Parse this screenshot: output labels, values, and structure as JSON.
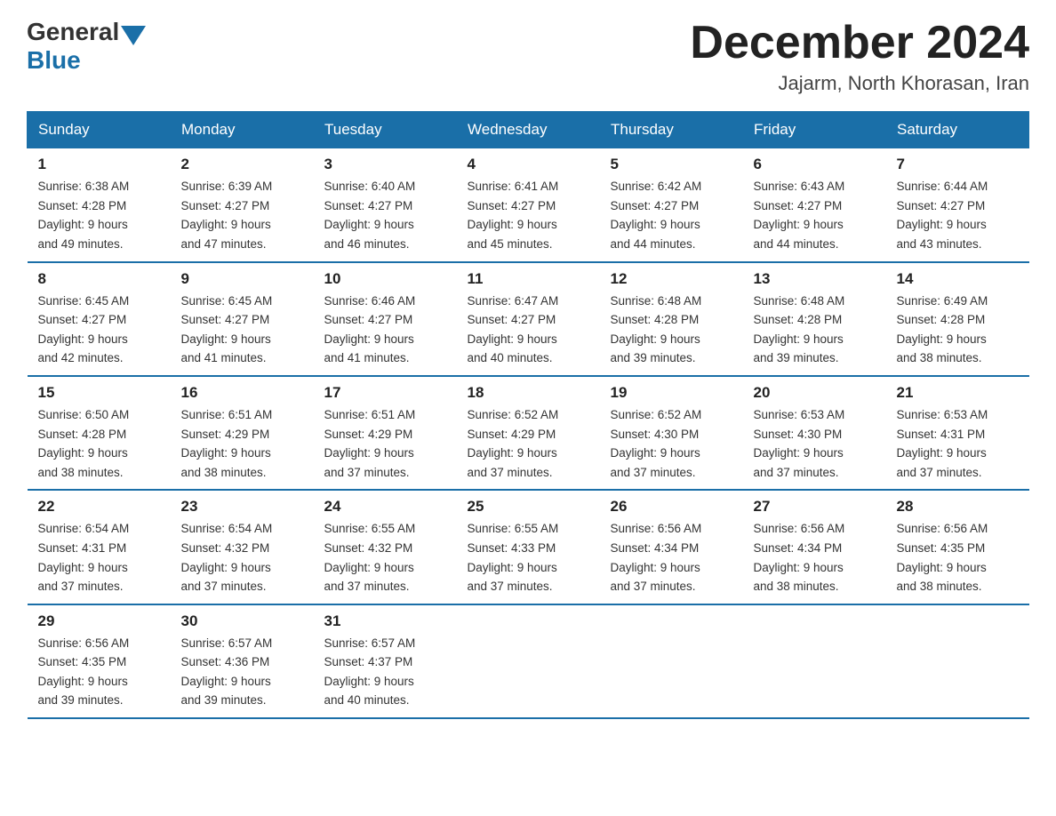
{
  "header": {
    "logo": {
      "general": "General",
      "blue": "Blue"
    },
    "title": "December 2024",
    "location": "Jajarm, North Khorasan, Iran"
  },
  "weekdays": [
    "Sunday",
    "Monday",
    "Tuesday",
    "Wednesday",
    "Thursday",
    "Friday",
    "Saturday"
  ],
  "weeks": [
    [
      {
        "day": "1",
        "sunrise": "6:38 AM",
        "sunset": "4:28 PM",
        "daylight": "9 hours and 49 minutes."
      },
      {
        "day": "2",
        "sunrise": "6:39 AM",
        "sunset": "4:27 PM",
        "daylight": "9 hours and 47 minutes."
      },
      {
        "day": "3",
        "sunrise": "6:40 AM",
        "sunset": "4:27 PM",
        "daylight": "9 hours and 46 minutes."
      },
      {
        "day": "4",
        "sunrise": "6:41 AM",
        "sunset": "4:27 PM",
        "daylight": "9 hours and 45 minutes."
      },
      {
        "day": "5",
        "sunrise": "6:42 AM",
        "sunset": "4:27 PM",
        "daylight": "9 hours and 44 minutes."
      },
      {
        "day": "6",
        "sunrise": "6:43 AM",
        "sunset": "4:27 PM",
        "daylight": "9 hours and 44 minutes."
      },
      {
        "day": "7",
        "sunrise": "6:44 AM",
        "sunset": "4:27 PM",
        "daylight": "9 hours and 43 minutes."
      }
    ],
    [
      {
        "day": "8",
        "sunrise": "6:45 AM",
        "sunset": "4:27 PM",
        "daylight": "9 hours and 42 minutes."
      },
      {
        "day": "9",
        "sunrise": "6:45 AM",
        "sunset": "4:27 PM",
        "daylight": "9 hours and 41 minutes."
      },
      {
        "day": "10",
        "sunrise": "6:46 AM",
        "sunset": "4:27 PM",
        "daylight": "9 hours and 41 minutes."
      },
      {
        "day": "11",
        "sunrise": "6:47 AM",
        "sunset": "4:27 PM",
        "daylight": "9 hours and 40 minutes."
      },
      {
        "day": "12",
        "sunrise": "6:48 AM",
        "sunset": "4:28 PM",
        "daylight": "9 hours and 39 minutes."
      },
      {
        "day": "13",
        "sunrise": "6:48 AM",
        "sunset": "4:28 PM",
        "daylight": "9 hours and 39 minutes."
      },
      {
        "day": "14",
        "sunrise": "6:49 AM",
        "sunset": "4:28 PM",
        "daylight": "9 hours and 38 minutes."
      }
    ],
    [
      {
        "day": "15",
        "sunrise": "6:50 AM",
        "sunset": "4:28 PM",
        "daylight": "9 hours and 38 minutes."
      },
      {
        "day": "16",
        "sunrise": "6:51 AM",
        "sunset": "4:29 PM",
        "daylight": "9 hours and 38 minutes."
      },
      {
        "day": "17",
        "sunrise": "6:51 AM",
        "sunset": "4:29 PM",
        "daylight": "9 hours and 37 minutes."
      },
      {
        "day": "18",
        "sunrise": "6:52 AM",
        "sunset": "4:29 PM",
        "daylight": "9 hours and 37 minutes."
      },
      {
        "day": "19",
        "sunrise": "6:52 AM",
        "sunset": "4:30 PM",
        "daylight": "9 hours and 37 minutes."
      },
      {
        "day": "20",
        "sunrise": "6:53 AM",
        "sunset": "4:30 PM",
        "daylight": "9 hours and 37 minutes."
      },
      {
        "day": "21",
        "sunrise": "6:53 AM",
        "sunset": "4:31 PM",
        "daylight": "9 hours and 37 minutes."
      }
    ],
    [
      {
        "day": "22",
        "sunrise": "6:54 AM",
        "sunset": "4:31 PM",
        "daylight": "9 hours and 37 minutes."
      },
      {
        "day": "23",
        "sunrise": "6:54 AM",
        "sunset": "4:32 PM",
        "daylight": "9 hours and 37 minutes."
      },
      {
        "day": "24",
        "sunrise": "6:55 AM",
        "sunset": "4:32 PM",
        "daylight": "9 hours and 37 minutes."
      },
      {
        "day": "25",
        "sunrise": "6:55 AM",
        "sunset": "4:33 PM",
        "daylight": "9 hours and 37 minutes."
      },
      {
        "day": "26",
        "sunrise": "6:56 AM",
        "sunset": "4:34 PM",
        "daylight": "9 hours and 37 minutes."
      },
      {
        "day": "27",
        "sunrise": "6:56 AM",
        "sunset": "4:34 PM",
        "daylight": "9 hours and 38 minutes."
      },
      {
        "day": "28",
        "sunrise": "6:56 AM",
        "sunset": "4:35 PM",
        "daylight": "9 hours and 38 minutes."
      }
    ],
    [
      {
        "day": "29",
        "sunrise": "6:56 AM",
        "sunset": "4:35 PM",
        "daylight": "9 hours and 39 minutes."
      },
      {
        "day": "30",
        "sunrise": "6:57 AM",
        "sunset": "4:36 PM",
        "daylight": "9 hours and 39 minutes."
      },
      {
        "day": "31",
        "sunrise": "6:57 AM",
        "sunset": "4:37 PM",
        "daylight": "9 hours and 40 minutes."
      },
      null,
      null,
      null,
      null
    ]
  ],
  "labels": {
    "sunrise": "Sunrise:",
    "sunset": "Sunset:",
    "daylight": "Daylight:"
  }
}
